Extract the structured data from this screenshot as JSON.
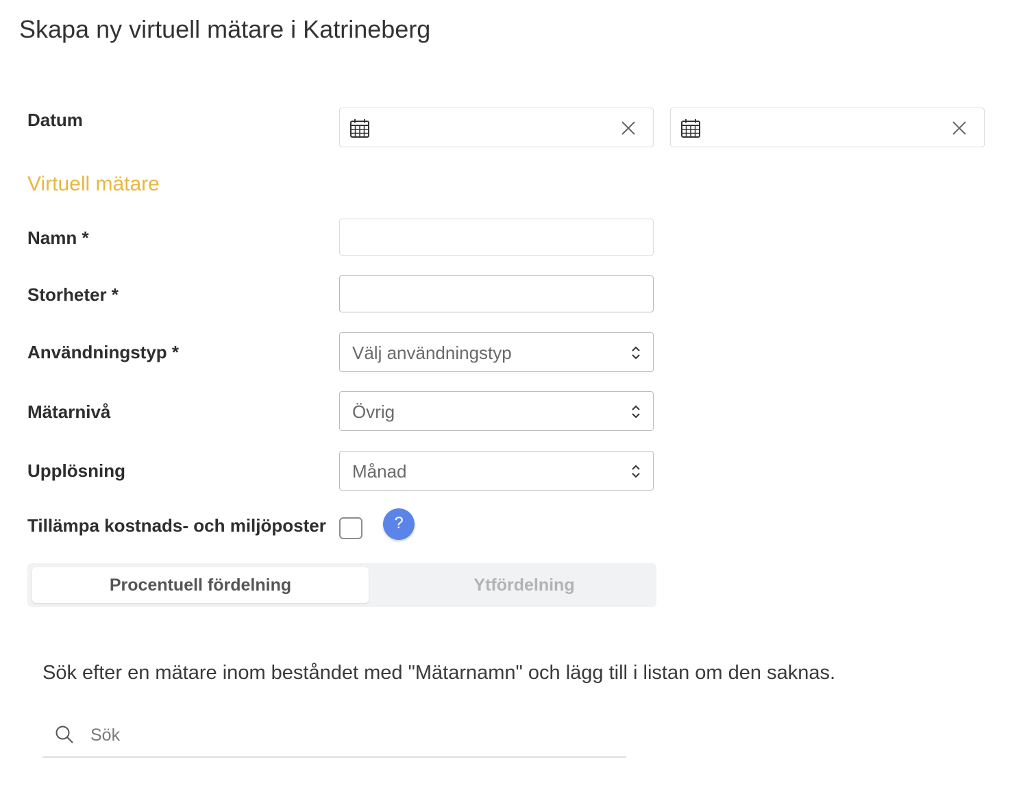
{
  "page": {
    "title": "Skapa ny virtuell mätare i Katrineberg"
  },
  "datum": {
    "label": "Datum",
    "from": {
      "value": "",
      "icon": "calendar-icon",
      "clear_icon": "close-icon"
    },
    "to": {
      "value": "",
      "icon": "calendar-icon",
      "clear_icon": "close-icon"
    }
  },
  "section": {
    "title": "Virtuell mätare"
  },
  "form": {
    "namn": {
      "label": "Namn *",
      "value": ""
    },
    "storheter": {
      "label": "Storheter *",
      "value": ""
    },
    "anvandningstyp": {
      "label": "Användningstyp *",
      "value": "Välj användningstyp"
    },
    "matarniva": {
      "label": "Mätarnivå",
      "value": "Övrig"
    },
    "upplosning": {
      "label": "Upplösning",
      "value": "Månad"
    },
    "tillampa": {
      "label": "Tillämpa kostnads- och miljöposter",
      "checked": false,
      "help": "?"
    }
  },
  "tabs": [
    {
      "label": "Procentuell fördelning",
      "active": true
    },
    {
      "label": "Ytfördelning",
      "active": false
    }
  ],
  "instruction": "Sök efter en mätare inom beståndet med \"Mätarnamn\" och lägg till i listan om den saknas.",
  "search": {
    "placeholder": "Sök",
    "icon": "search-icon"
  },
  "colors": {
    "accent": "#e8b73e",
    "help": "#5b84e8"
  }
}
